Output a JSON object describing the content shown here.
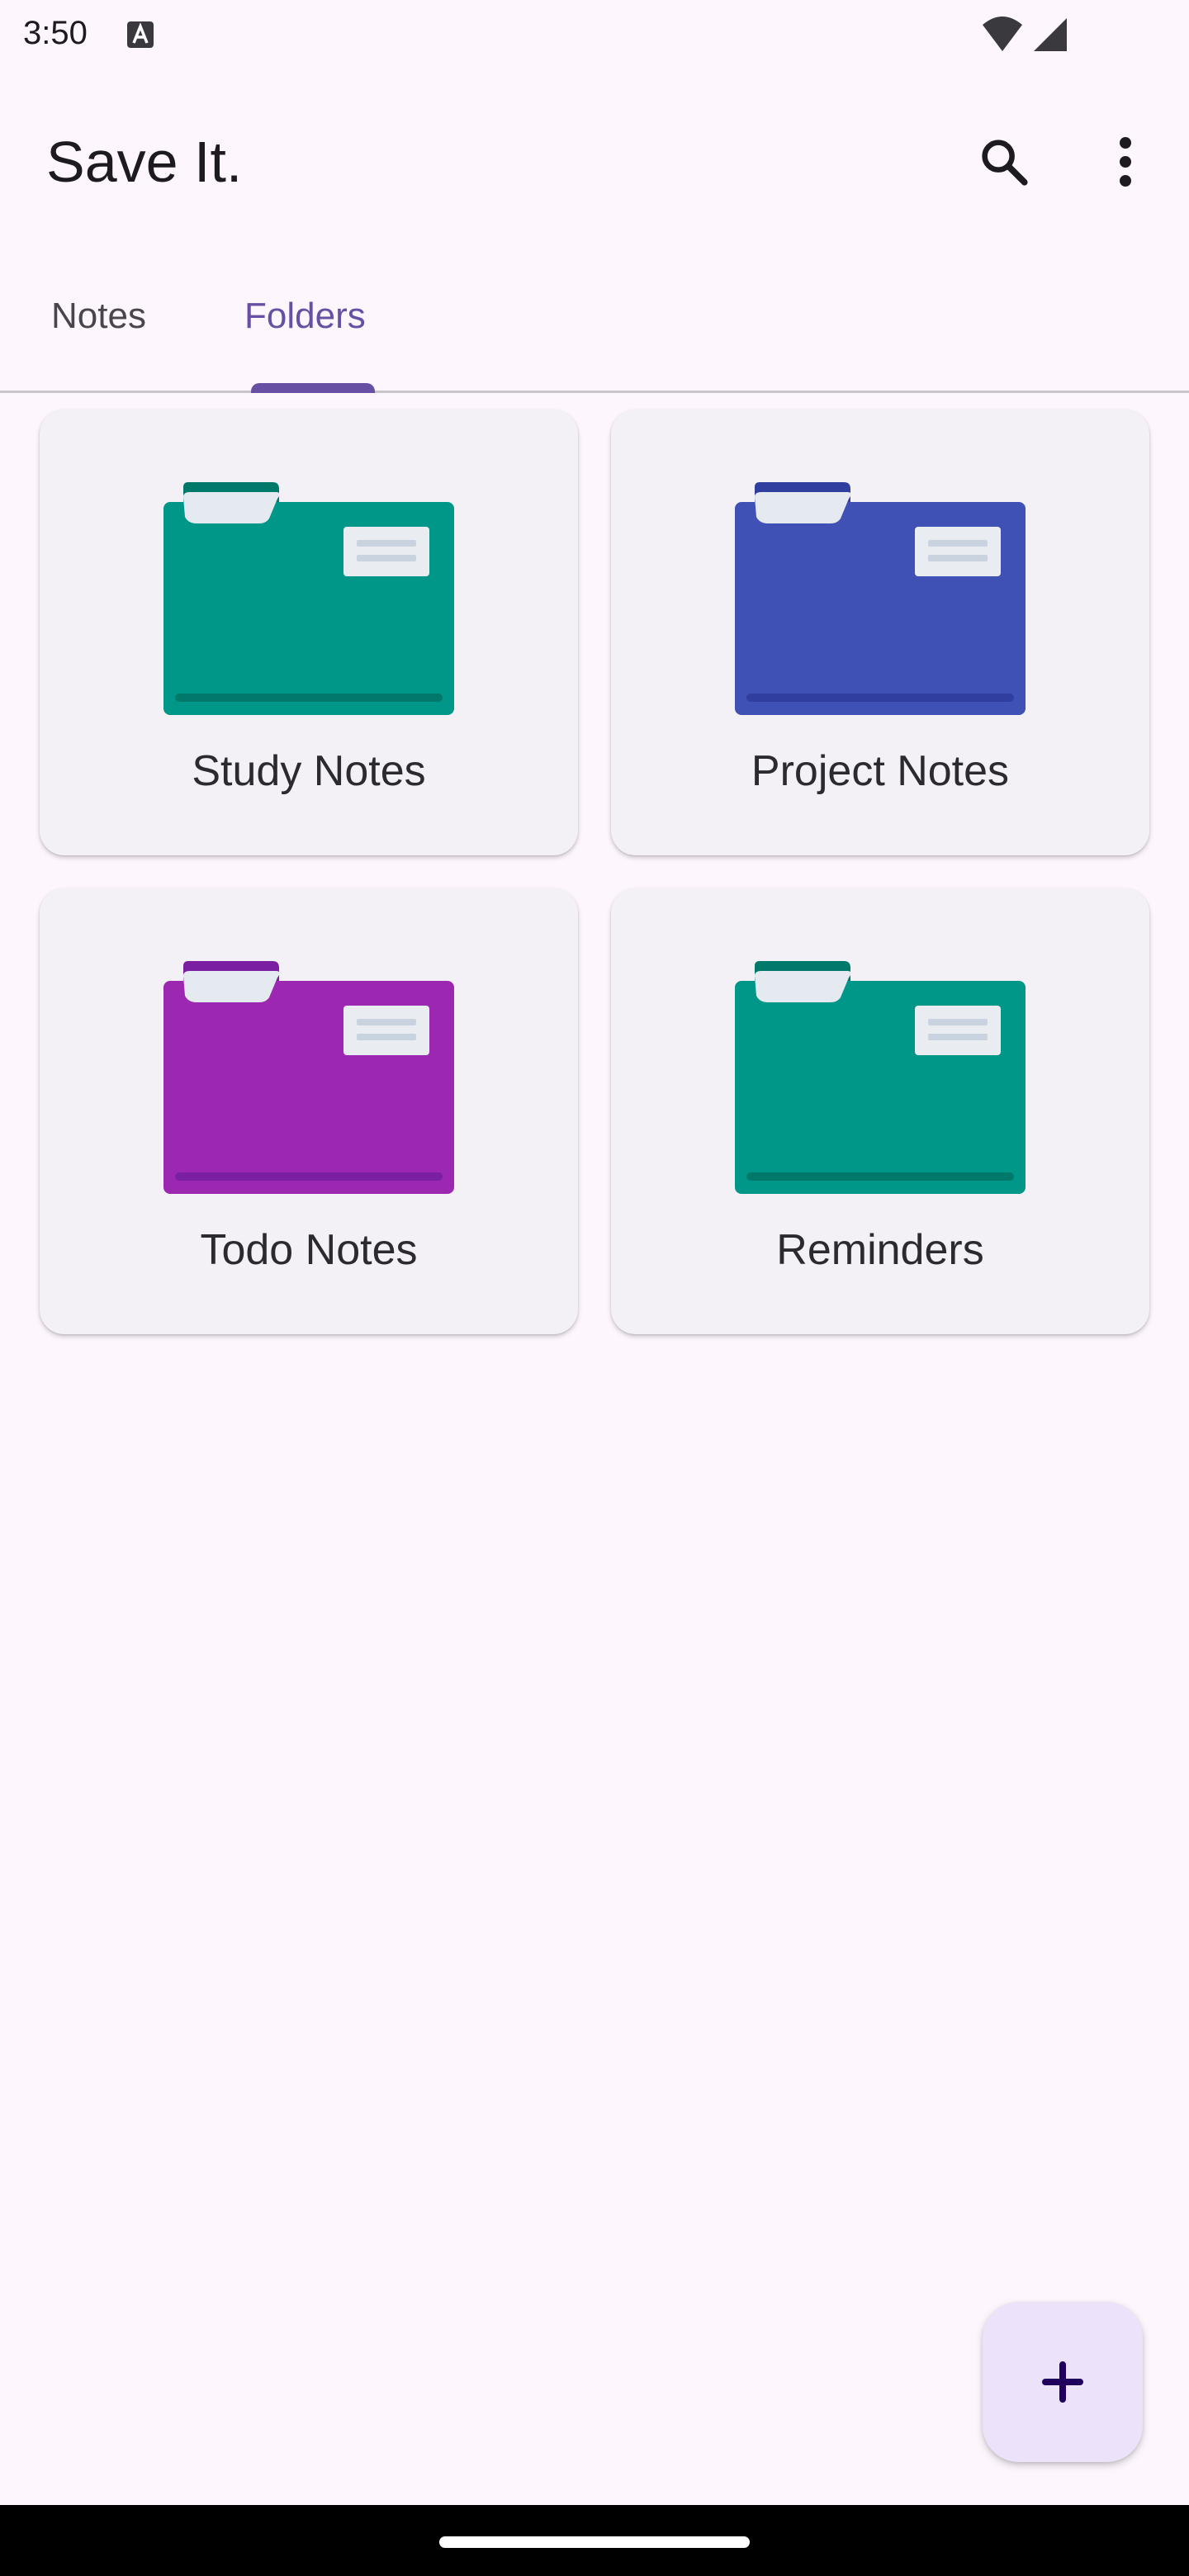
{
  "status_bar": {
    "time": "3:50"
  },
  "app_bar": {
    "title": "Save It.",
    "search_icon": "search-icon",
    "more_icon": "more-vert-icon"
  },
  "tabs": [
    {
      "label": "Notes",
      "selected": false
    },
    {
      "label": "Folders",
      "selected": true
    }
  ],
  "folders": [
    {
      "name": "Study Notes",
      "color": "#009688",
      "dark_color": "#00796b"
    },
    {
      "name": "Project Notes",
      "color": "#3f51b5",
      "dark_color": "#303f9f"
    },
    {
      "name": "Todo Notes",
      "color": "#9c27b0",
      "dark_color": "#7b1fa2"
    },
    {
      "name": "Reminders",
      "color": "#009688",
      "dark_color": "#00796b"
    }
  ],
  "fab": {
    "icon": "add-icon"
  },
  "colors": {
    "accent": "#6750a4",
    "background": "#fdf7fd",
    "card": "#f4f1f6"
  }
}
